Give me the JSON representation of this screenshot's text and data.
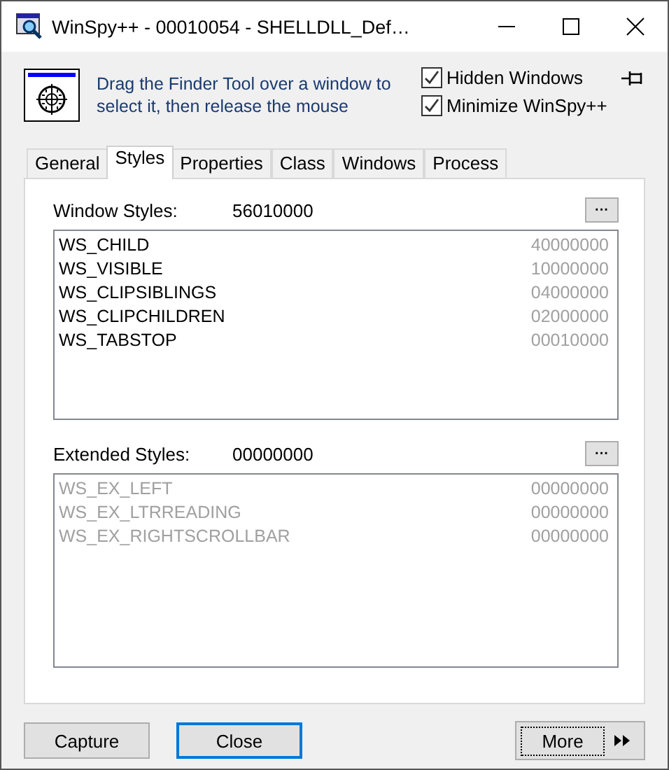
{
  "window": {
    "title": "WinSpy++ - 00010054 - SHELLDLL_Def…"
  },
  "finder": {
    "hint": "Drag the Finder Tool over a window to select it, then release the mouse"
  },
  "options": [
    {
      "label": "Hidden Windows",
      "checked": true
    },
    {
      "label": "Minimize WinSpy++",
      "checked": true
    }
  ],
  "tabs": [
    {
      "label": "General",
      "selected": false
    },
    {
      "label": "Styles",
      "selected": true
    },
    {
      "label": "Properties",
      "selected": false
    },
    {
      "label": "Class",
      "selected": false
    },
    {
      "label": "Windows",
      "selected": false
    },
    {
      "label": "Process",
      "selected": false
    }
  ],
  "sections": [
    {
      "label": "Window Styles:",
      "value": "56010000",
      "button": "···",
      "disabled": false,
      "items": [
        {
          "name": "WS_CHILD",
          "value": "40000000"
        },
        {
          "name": "WS_VISIBLE",
          "value": "10000000"
        },
        {
          "name": "WS_CLIPSIBLINGS",
          "value": "04000000"
        },
        {
          "name": "WS_CLIPCHILDREN",
          "value": "02000000"
        },
        {
          "name": "WS_TABSTOP",
          "value": "00010000"
        }
      ]
    },
    {
      "label": "Extended Styles:",
      "value": "00000000",
      "button": "···",
      "disabled": true,
      "items": [
        {
          "name": "WS_EX_LEFT",
          "value": "00000000"
        },
        {
          "name": "WS_EX_LTRREADING",
          "value": "00000000"
        },
        {
          "name": "WS_EX_RIGHTSCROLLBAR",
          "value": "00000000"
        }
      ]
    }
  ],
  "buttons": [
    {
      "label": "Capture",
      "kind": "plain"
    },
    {
      "label": "Close",
      "kind": "default"
    }
  ],
  "more": {
    "label": "More"
  }
}
